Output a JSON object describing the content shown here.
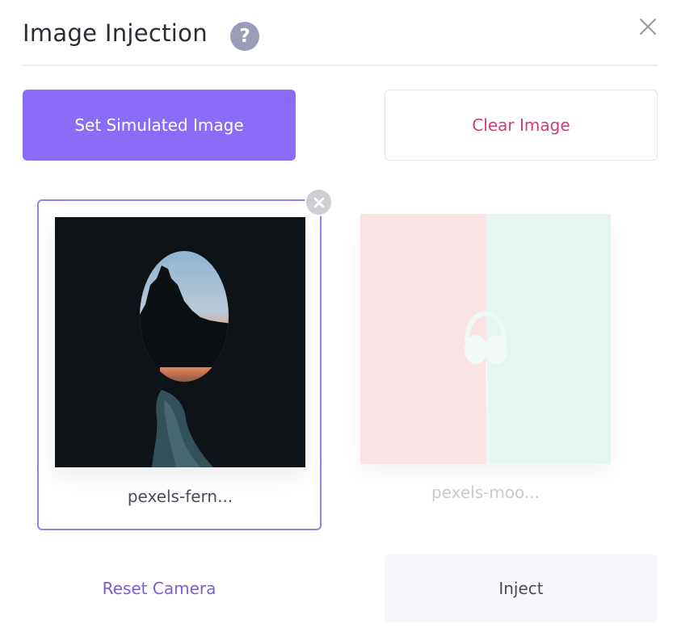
{
  "dialog": {
    "title": "Image Injection",
    "help_icon": "question-circle-icon",
    "close_icon": "close-x-icon"
  },
  "actions": {
    "set_label": "Set Simulated Image",
    "clear_label": "Clear Image",
    "reset_label": "Reset Camera",
    "inject_label": "Inject"
  },
  "images": [
    {
      "caption": "pexels-fern...",
      "selected": true
    },
    {
      "caption": "pexels-moo...",
      "selected": false
    }
  ],
  "colors": {
    "primary": "#8b6cf6",
    "danger_text": "#cf3b7c",
    "selected_border": "#9a7fe4",
    "link_text": "#7b5cd6"
  }
}
